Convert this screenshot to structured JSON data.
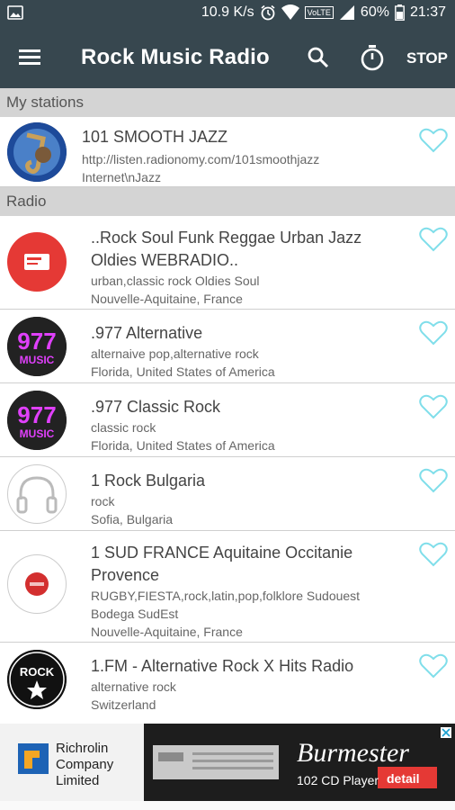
{
  "status": {
    "speed": "10.9 K/s",
    "volte": "VoLTE",
    "battery": "60%",
    "time": "21:37"
  },
  "appbar": {
    "title": "Rock Music Radio",
    "stop_label": "STOP"
  },
  "my_stations": {
    "header": "My stations",
    "items": [
      {
        "name": "101 SMOOTH JAZZ",
        "url": "http://listen.radionomy.com/101smoothjazz",
        "genre": "Internet\\nJazz"
      }
    ]
  },
  "radio": {
    "header": "Radio",
    "items": [
      {
        "name_line1": "..Rock Soul Funk Reggae Urban Jazz",
        "name_line2": "Oldies WEBRADIO..",
        "tags": "urban,classic rock Oldies Soul",
        "location": "Nouvelle-Aquitaine, France"
      },
      {
        "name": ".977 Alternative",
        "tags": "alternaive pop,alternative rock",
        "location": "Florida, United States of America",
        "logo_text": "977",
        "logo_sub": "MUSIC"
      },
      {
        "name": ".977 Classic Rock",
        "tags": "classic rock",
        "location": "Florida, United States of America",
        "logo_text": "977",
        "logo_sub": "MUSIC"
      },
      {
        "name": "1 Rock Bulgaria",
        "tags": "rock",
        "location": "Sofia, Bulgaria"
      },
      {
        "name_line1": "1 SUD FRANCE Aquitaine Occitanie",
        "name_line2": "Provence",
        "tags_line1": "RUGBY,FIESTA,rock,latin,pop,folklore Sudouest",
        "tags_line2": "Bodega SudEst",
        "location": "Nouvelle-Aquitaine, France"
      },
      {
        "name": "1.FM - Alternative Rock X Hits Radio",
        "tags": "alternative rock",
        "location": "Switzerland",
        "logo_text": "ROCK"
      }
    ]
  },
  "ad": {
    "company_line1": "Richrolin",
    "company_line2": "Company",
    "company_line3": "Limited",
    "brand": "Burmester",
    "product": "102 CD Player",
    "cta": "detail"
  },
  "colors": {
    "appbar": "#37474f",
    "heart": "#80deea",
    "section": "#d4d4d4"
  }
}
